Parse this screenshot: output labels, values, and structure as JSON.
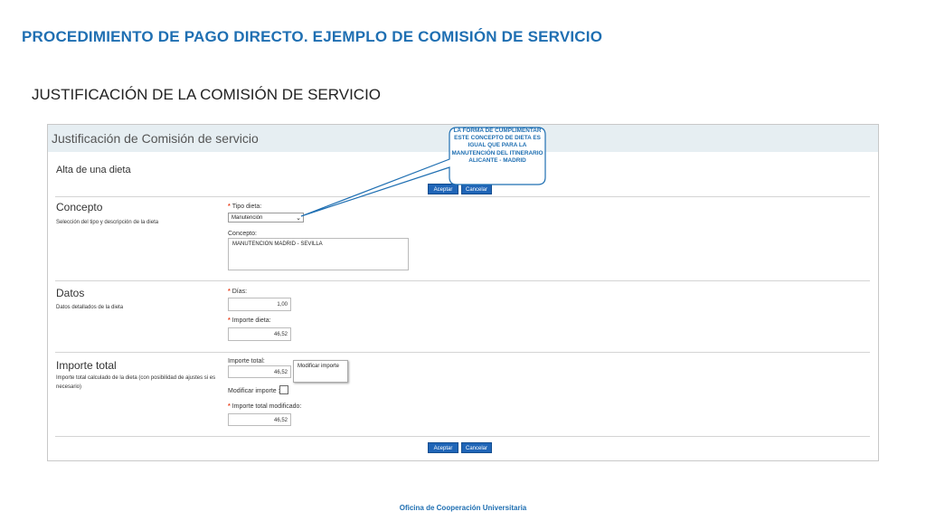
{
  "slide": {
    "title": "PROCEDIMIENTO DE PAGO DIRECTO. EJEMPLO DE COMISIÓN DE SERVICIO",
    "subtitle": "JUSTIFICACIÓN DE LA COMISIÓN DE SERVICIO",
    "footer": "Oficina de Cooperación Universitaria"
  },
  "form": {
    "window_title": "Justificación de Comisión de servicio",
    "subheading": "Alta de una dieta",
    "top_buttons": {
      "accept": "Aceptar",
      "cancel": "Cancelar"
    },
    "bottom_buttons": {
      "accept": "Aceptar",
      "cancel": "Cancelar"
    },
    "concepto": {
      "title": "Concepto",
      "description": "Selección del tipo y descripción de la dieta",
      "tipo_label": "Tipo dieta:",
      "tipo_value": "Manutención",
      "concepto_label": "Concepto:",
      "concepto_value": "MANUTENCION MADRID - SEVILLA"
    },
    "datos": {
      "title": "Datos",
      "description": "Datos detallados de la dieta",
      "dias_label": "Días:",
      "dias_value": "1,00",
      "importe_label": "Importe dieta:",
      "importe_value": "46,52"
    },
    "importe_total": {
      "title": "Importe total",
      "description": "Importe total calculado de la dieta (con posibilidad de ajustes si es necesario)",
      "total_label": "Importe total:",
      "total_value": "46,52",
      "modificar_label": "Modificar importe :",
      "modificado_label": "Importe total modificado:",
      "modificado_value": "46,52",
      "tooltip": "Modificar importe"
    }
  },
  "callout": {
    "text": "LA FORMA DE CUMPLIMENTAR ESTE CONCEPTO DE DIETA ES IGUAL QUE PARA LA MANUTENCIÓN DEL ITINERARIO ALICANTE - MADRID",
    "border_color": "#1f6fb2",
    "fill_color": "#ffffff"
  },
  "colors": {
    "accent": "#1f6fb2",
    "button": "#1f65b7",
    "required": "#e8401c"
  }
}
